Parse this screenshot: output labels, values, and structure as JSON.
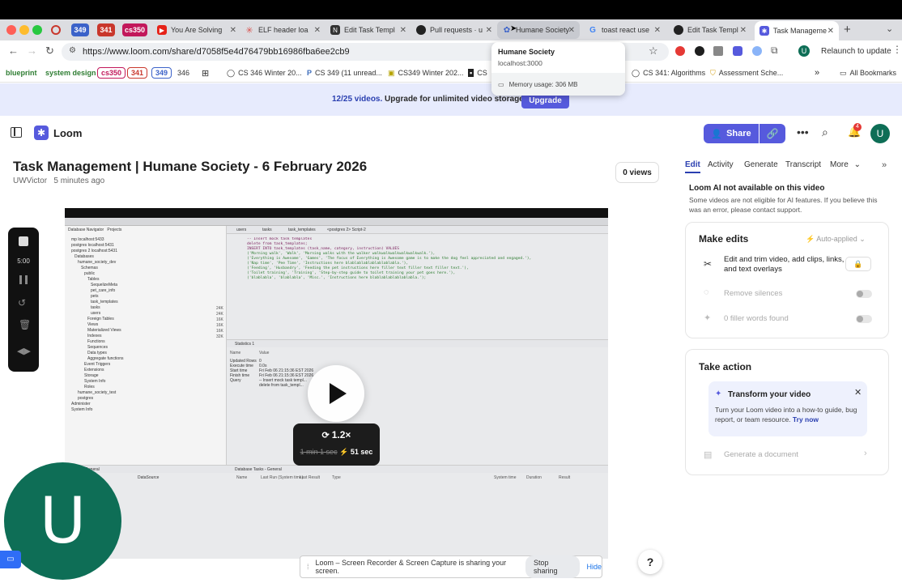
{
  "browser": {
    "tabs": [
      {
        "label": "349",
        "color": "#3b62c9"
      },
      {
        "label": "341",
        "color": "#c9372c"
      },
      {
        "label": "cs350",
        "color": "#c2185b"
      },
      {
        "label": "You Are Solving"
      },
      {
        "label": "ELF header loa"
      },
      {
        "label": "Edit Task Templ"
      },
      {
        "label": "Pull requests · u"
      },
      {
        "label": "Humane Society"
      },
      {
        "label": "toast react use"
      },
      {
        "label": "Edit Task Templ"
      },
      {
        "label": "Task Manageme"
      }
    ],
    "url": "https://www.loom.com/share/d7058f5e4d76479bb16986fba6ee2cb9",
    "relaunch_label": "Relaunch to update",
    "profile_initial": "U",
    "bookmarks": [
      {
        "label": "blueprint",
        "color": "#2e7d32"
      },
      {
        "label": "system design",
        "color": "#2e7d32"
      },
      {
        "label": "cs350",
        "color": "#c2185b"
      },
      {
        "label": "341",
        "color": "#c9372c"
      },
      {
        "label": "349",
        "color": "#3b62c9"
      },
      {
        "label": "346"
      },
      {
        "label": "CS 346 Winter 20..."
      },
      {
        "label": "CS 349 (11 unread..."
      },
      {
        "label": "CS349 Winter 202..."
      },
      {
        "label": "CS"
      },
      {
        "label": "CS 341: Algorithms"
      },
      {
        "label": "Assessment Sche..."
      }
    ],
    "all_bookmarks": "All Bookmarks",
    "hover_card": {
      "title": "Humane Society",
      "host": "localhost:3000",
      "memory": "Memory usage: 306 MB"
    }
  },
  "banner": {
    "count": "12/25 videos.",
    "text": "Upgrade for unlimited video storage.",
    "button": "Upgrade"
  },
  "header": {
    "brand": "Loom",
    "share_label": "Share",
    "notif_count": "4",
    "avatar": "U"
  },
  "video": {
    "title": "Task Management | Humane Society - 6 February 2026",
    "author": "UWVictor",
    "time_ago": "5 minutes ago",
    "views": "0 views",
    "speed": "1.2×",
    "orig_duration": "1 min 1 sec",
    "new_duration": "51 sec",
    "timer": "5:00",
    "avatar": "U"
  },
  "editor": {
    "nav_title": "Database Navigator",
    "projects": "Projects",
    "tree": [
      "mp  localhost:5433",
      "postgres  localhost:5431",
      "postgres 2  localhost:5431",
      "Databases",
      "humane_society_dev",
      "Schemas",
      "public",
      "Tables",
      "SequelizeMeta",
      "pet_care_info",
      "pets",
      "task_templates",
      "tasks",
      "users",
      "Foreign Tables",
      "Views",
      "Materialized Views",
      "Indexes",
      "Functions",
      "Sequences",
      "Data types",
      "Aggregate functions",
      "Event Triggers",
      "Extensions",
      "Storage",
      "System Info",
      "Roles",
      "humane_society_test",
      "postgres",
      "Administer",
      "System Info"
    ],
    "sizes": [
      "24K",
      "24K",
      "16K",
      "16K",
      "16K",
      "32K"
    ],
    "tabs": [
      "users",
      "tasks",
      "task_templates",
      "<postgres 2> Script-2"
    ],
    "sql": [
      "-- Insert mock task templates",
      "delete from task_templates;",
      "INSERT INTO task_templates (task_name, category, instruction) VALUES",
      "('Morning walk', 'Walk', 'Morning walks with the walker walkwalkwalkwalkwalkwalk.'),",
      "('Everything is Awesome', 'Games', 'The focus of Everything is Awesome game is to make the dog feel appreciated and engaged.'),",
      "('Nap time', 'Pee Time', 'Instructions here blablablablablablablabla.'),",
      "('Feeding', 'Husbandry', 'Feeding the pet instructions here filler text filler text filler text.'),",
      "('Toilet training', 'Training', 'Step-by-step guide to toilet training your pet goes here.'),",
      "('blablabla', 'blablabla', 'Misc.', 'Instructions here blablablablablablabla.');"
    ],
    "stats_tab": "Statistics 1",
    "stats_headers": [
      "Name",
      "Value"
    ],
    "stats": [
      [
        "Updated Rows",
        "0"
      ],
      [
        "Execute time",
        "0.0s"
      ],
      [
        "Start time",
        "Fri Feb 06 21:15:36 EST 2026"
      ],
      [
        "Finish time",
        "Fri Feb 06 21:15:36 EST 2026"
      ],
      [
        "Query",
        "-- Insert mock task templ..."
      ],
      [
        "",
        "delete from task_templ..."
      ]
    ],
    "files_tab": "Files - General",
    "datasource": "DataSource",
    "tasks_tab": "Database Tasks - General",
    "task_headers": [
      "Name",
      "Last Run (System time)",
      "Last Result",
      "Type",
      "System time",
      "Duration",
      "Result"
    ]
  },
  "right": {
    "tabs": [
      "Edit",
      "Activity",
      "Generate",
      "Transcript",
      "More"
    ],
    "ai_title": "Loom AI not available on this video",
    "ai_text": "Some videos are not eligible for AI features. If you believe this was an error, please contact support.",
    "make_edits": "Make edits",
    "auto_applied": "Auto-applied",
    "edit_text": "Edit and trim video, add clips, links, and text overlays",
    "remove_silences": "Remove silences",
    "filler": "0 filler words found",
    "take_action": "Take action",
    "transform_title": "Transform your video",
    "transform_text": "Turn your Loom video into a how-to guide, bug report, or team resource.",
    "try_now": "Try now",
    "generate_doc": "Generate a document"
  },
  "sharing": {
    "text": "Loom – Screen Recorder & Screen Capture is sharing your screen.",
    "stop": "Stop sharing",
    "hide": "Hide"
  },
  "help": "?"
}
